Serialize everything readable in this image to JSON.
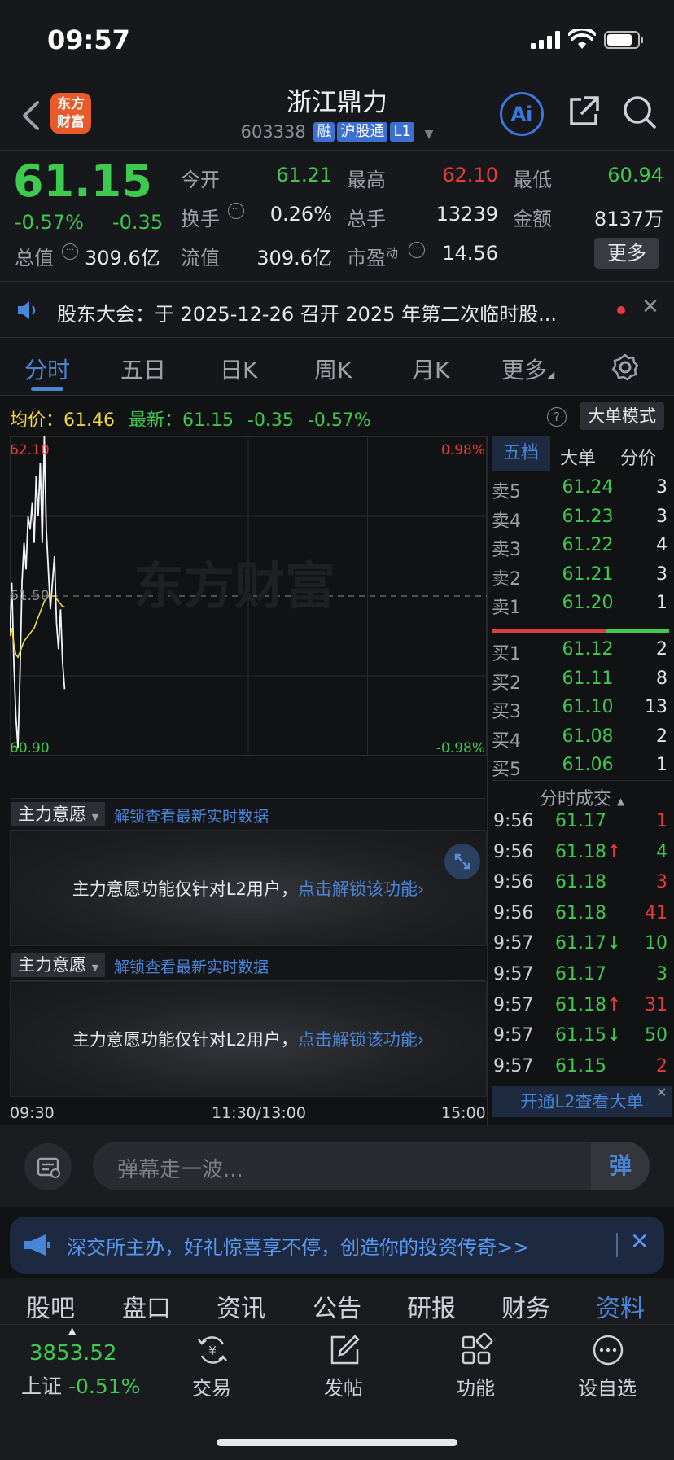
{
  "status_bar": {
    "time": "09:57"
  },
  "header": {
    "title": "浙江鼎力",
    "code": "603338",
    "tags": [
      "融",
      "沪股通",
      "L1"
    ],
    "logo_text_top": "东方",
    "logo_text_bottom": "财富",
    "ai_label": "Ai"
  },
  "quote": {
    "price": "61.15",
    "change_pct": "-0.57%",
    "change": "-0.35",
    "fields": {
      "open_label": "今开",
      "open": "61.21",
      "high_label": "最高",
      "high": "62.10",
      "low_label": "最低",
      "low": "60.94",
      "turnover_label": "换手",
      "turnover": "0.26%",
      "volume_label": "总手",
      "volume": "13239",
      "amount_label": "金额",
      "amount": "8137万",
      "mktcap_label": "总值",
      "mktcap": "309.6亿",
      "float_label": "流值",
      "float": "309.6亿",
      "pe_label": "市盈",
      "pe_sup": "动",
      "pe": "14.56"
    },
    "more_button": "更多"
  },
  "notice": {
    "text": "股东大会：于 2025-12-26 召开 2025 年第二次临时股..."
  },
  "tabs": [
    "分时",
    "五日",
    "日K",
    "周K",
    "月K",
    "更多"
  ],
  "active_tab": 0,
  "chart_info": {
    "avg_label": "均价：",
    "avg": "61.46",
    "last_label": "最新：",
    "last": "61.15",
    "change": "-0.35",
    "change_pct": "-0.57%",
    "mode_button": "大单模式",
    "help_glyph": "?"
  },
  "chart_data": {
    "type": "line",
    "y_max_label": "62.10",
    "y_mid_label": "61.50",
    "y_min_label": "60.90",
    "pct_max_label": "0.98%",
    "pct_min_label": "-0.98%",
    "ylim": [
      60.9,
      62.1
    ],
    "x_labels": [
      "09:30",
      "11:30/13:00",
      "15:00"
    ],
    "watermark": "东方财富",
    "series": [
      {
        "values": [
          61.35,
          61.55,
          61.25,
          61.05,
          60.93,
          61.2,
          61.55,
          61.7,
          61.6,
          61.8,
          61.75,
          61.85,
          61.7,
          61.95,
          61.8,
          62.0,
          61.7,
          62.1,
          61.75,
          61.6,
          61.45,
          61.55,
          61.65,
          61.4,
          61.3,
          61.45,
          61.25,
          61.15
        ]
      },
      {
        "values": [
          61.35,
          61.38,
          61.32,
          61.28,
          61.27,
          61.29,
          61.31,
          61.33,
          61.34,
          61.35,
          61.36,
          61.37,
          61.38,
          61.4,
          61.42,
          61.44,
          61.46,
          61.48,
          61.49,
          61.5,
          61.5,
          61.5,
          61.5,
          61.49,
          61.48,
          61.47,
          61.46,
          61.46
        ]
      }
    ]
  },
  "orderbook": {
    "tabs": [
      "五档",
      "大单",
      "分价"
    ],
    "asks": [
      {
        "label": "卖5",
        "price": "61.24",
        "vol": "3"
      },
      {
        "label": "卖4",
        "price": "61.23",
        "vol": "3"
      },
      {
        "label": "卖3",
        "price": "61.22",
        "vol": "4"
      },
      {
        "label": "卖2",
        "price": "61.21",
        "vol": "3"
      },
      {
        "label": "卖1",
        "price": "61.20",
        "vol": "1"
      }
    ],
    "bids": [
      {
        "label": "买1",
        "price": "61.12",
        "vol": "2"
      },
      {
        "label": "买2",
        "price": "61.11",
        "vol": "8"
      },
      {
        "label": "买3",
        "price": "61.10",
        "vol": "13"
      },
      {
        "label": "买4",
        "price": "61.08",
        "vol": "2"
      },
      {
        "label": "买5",
        "price": "61.06",
        "vol": "1"
      }
    ],
    "ticks_title": "分时成交",
    "ticks": [
      {
        "time": "9:56",
        "price": "61.17",
        "arrow": "",
        "vol": "1",
        "vol_color": "#e83a3a"
      },
      {
        "time": "9:56",
        "price": "61.18",
        "arrow": "↑",
        "vol": "4",
        "vol_color": "#3ec94f"
      },
      {
        "time": "9:56",
        "price": "61.18",
        "arrow": "",
        "vol": "3",
        "vol_color": "#e83a3a"
      },
      {
        "time": "9:56",
        "price": "61.18",
        "arrow": "",
        "vol": "41",
        "vol_color": "#e83a3a"
      },
      {
        "time": "9:57",
        "price": "61.17",
        "arrow": "↓",
        "vol": "10",
        "vol_color": "#3ec94f"
      },
      {
        "time": "9:57",
        "price": "61.17",
        "arrow": "",
        "vol": "3",
        "vol_color": "#3ec94f"
      },
      {
        "time": "9:57",
        "price": "61.18",
        "arrow": "↑",
        "vol": "31",
        "vol_color": "#e83a3a"
      },
      {
        "time": "9:57",
        "price": "61.15",
        "arrow": "↓",
        "vol": "50",
        "vol_color": "#3ec94f"
      },
      {
        "time": "9:57",
        "price": "61.15",
        "arrow": "",
        "vol": "2",
        "vol_color": "#e83a3a"
      }
    ],
    "l2_banner": "开通L2查看大单"
  },
  "main_force": {
    "label": "主力意愿",
    "unlock_link": "解锁查看最新实时数据",
    "lock_text": "主力意愿功能仅针对L2用户，",
    "lock_link": "点击解锁该功能"
  },
  "danmu": {
    "placeholder": "弹幕走一波...",
    "send": "弹"
  },
  "promo": {
    "text": "深交所主办，好礼惊喜享不停，创造你的投资传奇>>"
  },
  "subtabs": [
    "股吧",
    "盘口",
    "资讯",
    "公告",
    "研报",
    "财务",
    "资料"
  ],
  "active_subtab": 6,
  "bottom_nav": {
    "index_value": "3853.52",
    "index_name": "上证",
    "index_change": "-0.51%",
    "items": [
      "交易",
      "发帖",
      "功能",
      "设自选"
    ]
  },
  "colors": {
    "up": "#e83a3a",
    "down": "#3ec94f",
    "accent": "#4a86d8",
    "bg": "#111214"
  }
}
